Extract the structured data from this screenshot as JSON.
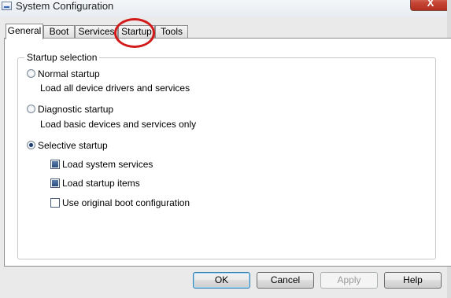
{
  "window": {
    "title": "System Configuration",
    "close_label": "X"
  },
  "tabs": [
    {
      "label": "General",
      "active": true
    },
    {
      "label": "Boot",
      "active": false
    },
    {
      "label": "Services",
      "active": false
    },
    {
      "label": "Startup",
      "active": false,
      "highlighted": true
    },
    {
      "label": "Tools",
      "active": false
    }
  ],
  "startup_selection": {
    "group_label": "Startup selection",
    "normal": {
      "label": "Normal startup",
      "description": "Load all device drivers and services",
      "selected": false
    },
    "diagnostic": {
      "label": "Diagnostic startup",
      "description": "Load basic devices and services only",
      "selected": false
    },
    "selective": {
      "label": "Selective startup",
      "selected": true
    },
    "options": {
      "load_system_services": {
        "label": "Load system services",
        "checked": true
      },
      "load_startup_items": {
        "label": "Load startup items",
        "checked": true
      },
      "use_original_boot_config": {
        "label": "Use original boot configuration",
        "checked": false
      }
    }
  },
  "buttons": {
    "ok": "OK",
    "cancel": "Cancel",
    "apply": "Apply",
    "help": "Help"
  },
  "annotation": {
    "color": "#d31a1a"
  }
}
